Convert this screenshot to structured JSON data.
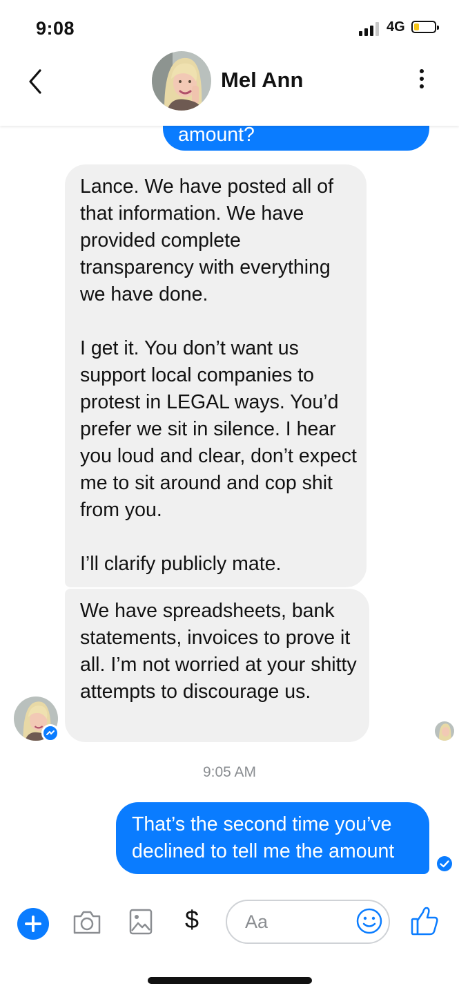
{
  "status_bar": {
    "time": "9:08",
    "network": "4G",
    "signal_bars_active": 3,
    "battery_level": 0.2,
    "battery_color": "#f5c518"
  },
  "header": {
    "contact_name": "Mel Ann",
    "back_icon": "chevron-left-icon",
    "more_icon": "more-vertical-icon"
  },
  "messages": [
    {
      "sender": "me",
      "text": "amount?"
    },
    {
      "sender": "them",
      "paragraphs": [
        "Lance. We have posted all of that information. We have provided complete transparency with everything we have done.",
        "I get it. You don’t want us support local companies to protest in LEGAL ways. You’d prefer we sit in silence. I hear you loud and clear, don’t expect me to sit around and cop shit from you.",
        "I’ll clarify publicly mate."
      ]
    },
    {
      "sender": "them",
      "text": "We have spreadsheets, bank statements, invoices to prove it all. I’m not worried at your shitty attempts to discourage us."
    },
    {
      "sender": "me",
      "text": "That’s the second time you’ve declined to tell me the amount"
    }
  ],
  "timestamp": "9:05 AM",
  "composer": {
    "placeholder": "Aa",
    "icons": [
      "plus-icon",
      "camera-icon",
      "image-icon",
      "dollar-icon",
      "emoji-icon",
      "like-icon"
    ],
    "dollar_label": "$"
  },
  "colors": {
    "accent": "#0a7cff",
    "incoming_bubble": "#f0f0f0",
    "timestamp": "#8a8d91"
  }
}
